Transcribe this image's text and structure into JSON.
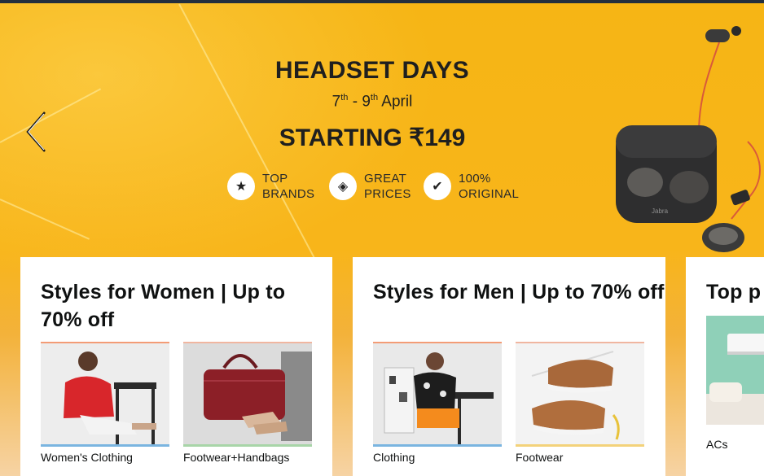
{
  "banner": {
    "title": "HEADSET DAYS",
    "date_start": "7",
    "date_start_suffix": "th",
    "date_sep": " - ",
    "date_end": "9",
    "date_end_suffix": "th",
    "date_month": " April",
    "price": "STARTING ₹149",
    "features": [
      {
        "line1": "TOP",
        "line2": "BRANDS",
        "icon": "star-hand-icon"
      },
      {
        "line1": "GREAT",
        "line2": "PRICES",
        "icon": "price-tag-icon"
      },
      {
        "line1": "100%",
        "line2": "ORIGINAL",
        "icon": "verified-badge-icon"
      }
    ],
    "product_brand": "Jabra"
  },
  "cards": [
    {
      "title": "Styles for Women | Up to 70% off",
      "tiles": [
        {
          "label": "Women's Clothing"
        },
        {
          "label": "Footwear+Handbags"
        }
      ]
    },
    {
      "title": "Styles for Men | Up to 70% off",
      "tiles": [
        {
          "label": "Clothing"
        },
        {
          "label": "Footwear"
        }
      ]
    },
    {
      "title": "Top p",
      "tiles": [
        {
          "label": "ACs"
        }
      ]
    }
  ],
  "colors": {
    "banner_yellow": "#f8b51a",
    "topbar": "#232f3e",
    "text_dark": "#0f1111"
  }
}
